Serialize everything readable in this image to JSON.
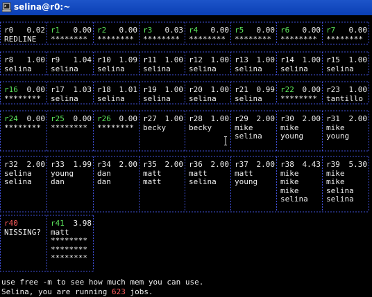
{
  "window": {
    "title": "selina@r0:~"
  },
  "nodes": [
    {
      "id": "r0",
      "load": "0.02",
      "lines": [
        "REDLINE"
      ],
      "state": "normal"
    },
    {
      "id": "r1",
      "load": "0.00",
      "lines": [
        "********"
      ],
      "state": "free"
    },
    {
      "id": "r2",
      "load": "0.00",
      "lines": [
        "********"
      ],
      "state": "free"
    },
    {
      "id": "r3",
      "load": "0.03",
      "lines": [
        "********"
      ],
      "state": "free"
    },
    {
      "id": "r4",
      "load": "0.00",
      "lines": [
        "********"
      ],
      "state": "free"
    },
    {
      "id": "r5",
      "load": "0.00",
      "lines": [
        "********"
      ],
      "state": "free"
    },
    {
      "id": "r6",
      "load": "0.00",
      "lines": [
        "********"
      ],
      "state": "free"
    },
    {
      "id": "r7",
      "load": "0.00",
      "lines": [
        "********"
      ],
      "state": "free"
    },
    {
      "id": "r8",
      "load": "1.00",
      "lines": [
        "selina"
      ],
      "state": "normal"
    },
    {
      "id": "r9",
      "load": "1.04",
      "lines": [
        "selina"
      ],
      "state": "normal"
    },
    {
      "id": "r10",
      "load": "1.09",
      "lines": [
        "selina"
      ],
      "state": "normal"
    },
    {
      "id": "r11",
      "load": "1.00",
      "lines": [
        "selina"
      ],
      "state": "normal"
    },
    {
      "id": "r12",
      "load": "1.00",
      "lines": [
        "selina"
      ],
      "state": "normal"
    },
    {
      "id": "r13",
      "load": "1.00",
      "lines": [
        "selina"
      ],
      "state": "normal"
    },
    {
      "id": "r14",
      "load": "1.00",
      "lines": [
        "selina"
      ],
      "state": "normal"
    },
    {
      "id": "r15",
      "load": "1.00",
      "lines": [
        "selina"
      ],
      "state": "normal"
    },
    {
      "id": "r16",
      "load": "0.00",
      "lines": [
        "********"
      ],
      "state": "free"
    },
    {
      "id": "r17",
      "load": "1.03",
      "lines": [
        "selina"
      ],
      "state": "normal"
    },
    {
      "id": "r18",
      "load": "1.01",
      "lines": [
        "selina"
      ],
      "state": "normal"
    },
    {
      "id": "r19",
      "load": "1.00",
      "lines": [
        "selina"
      ],
      "state": "normal"
    },
    {
      "id": "r20",
      "load": "1.00",
      "lines": [
        "selina"
      ],
      "state": "normal"
    },
    {
      "id": "r21",
      "load": "0.99",
      "lines": [
        "selina"
      ],
      "state": "normal"
    },
    {
      "id": "r22",
      "load": "0.00",
      "lines": [
        "********"
      ],
      "state": "free"
    },
    {
      "id": "r23",
      "load": "1.00",
      "lines": [
        "tantillo"
      ],
      "state": "normal"
    },
    {
      "id": "r24",
      "load": "0.00",
      "lines": [
        "********"
      ],
      "state": "free"
    },
    {
      "id": "r25",
      "load": "0.00",
      "lines": [
        "********"
      ],
      "state": "free"
    },
    {
      "id": "r26",
      "load": "0.00",
      "lines": [
        "********"
      ],
      "state": "free"
    },
    {
      "id": "r27",
      "load": "1.00",
      "lines": [
        "becky"
      ],
      "state": "normal"
    },
    {
      "id": "r28",
      "load": "1.00",
      "lines": [
        "becky"
      ],
      "state": "normal"
    },
    {
      "id": "r29",
      "load": "2.00",
      "lines": [
        "mike",
        "selina"
      ],
      "state": "normal"
    },
    {
      "id": "r30",
      "load": "2.00",
      "lines": [
        "mike",
        "young"
      ],
      "state": "normal"
    },
    {
      "id": "r31",
      "load": "2.00",
      "lines": [
        "mike",
        "young"
      ],
      "state": "normal"
    },
    {
      "id": "r32",
      "load": "2.00",
      "lines": [
        "selina",
        "selina"
      ],
      "state": "normal"
    },
    {
      "id": "r33",
      "load": "1.99",
      "lines": [
        "young",
        "dan"
      ],
      "state": "normal"
    },
    {
      "id": "r34",
      "load": "2.00",
      "lines": [
        "dan",
        "dan"
      ],
      "state": "normal"
    },
    {
      "id": "r35",
      "load": "2.00",
      "lines": [
        "matt",
        "matt"
      ],
      "state": "normal"
    },
    {
      "id": "r36",
      "load": "2.00",
      "lines": [
        "matt",
        "selina"
      ],
      "state": "normal"
    },
    {
      "id": "r37",
      "load": "2.00",
      "lines": [
        "matt",
        "young"
      ],
      "state": "normal"
    },
    {
      "id": "r38",
      "load": "4.43",
      "lines": [
        "mike",
        "mike",
        "mike",
        "selina"
      ],
      "state": "normal"
    },
    {
      "id": "r39",
      "load": "5.30",
      "lines": [
        "mike",
        "mike",
        "selina",
        "selina"
      ],
      "state": "normal"
    },
    {
      "id": "r40",
      "load": "",
      "lines": [
        "NISSING?"
      ],
      "state": "missing"
    },
    {
      "id": "r41",
      "load": "3.98",
      "lines": [
        "matt",
        "********",
        "********",
        "********"
      ],
      "state": "partial"
    }
  ],
  "messages": {
    "line1": "use free -m to see how much mem you can use.",
    "line2_prefix": "Selina, you are running ",
    "job_count": "623",
    "line2_suffix": " jobs."
  },
  "colors": {
    "free_id": "#5ce65c",
    "missing_id": "#ff5c5c",
    "grid_line": "#4050d8",
    "titlebar": "#0a3fb4"
  }
}
